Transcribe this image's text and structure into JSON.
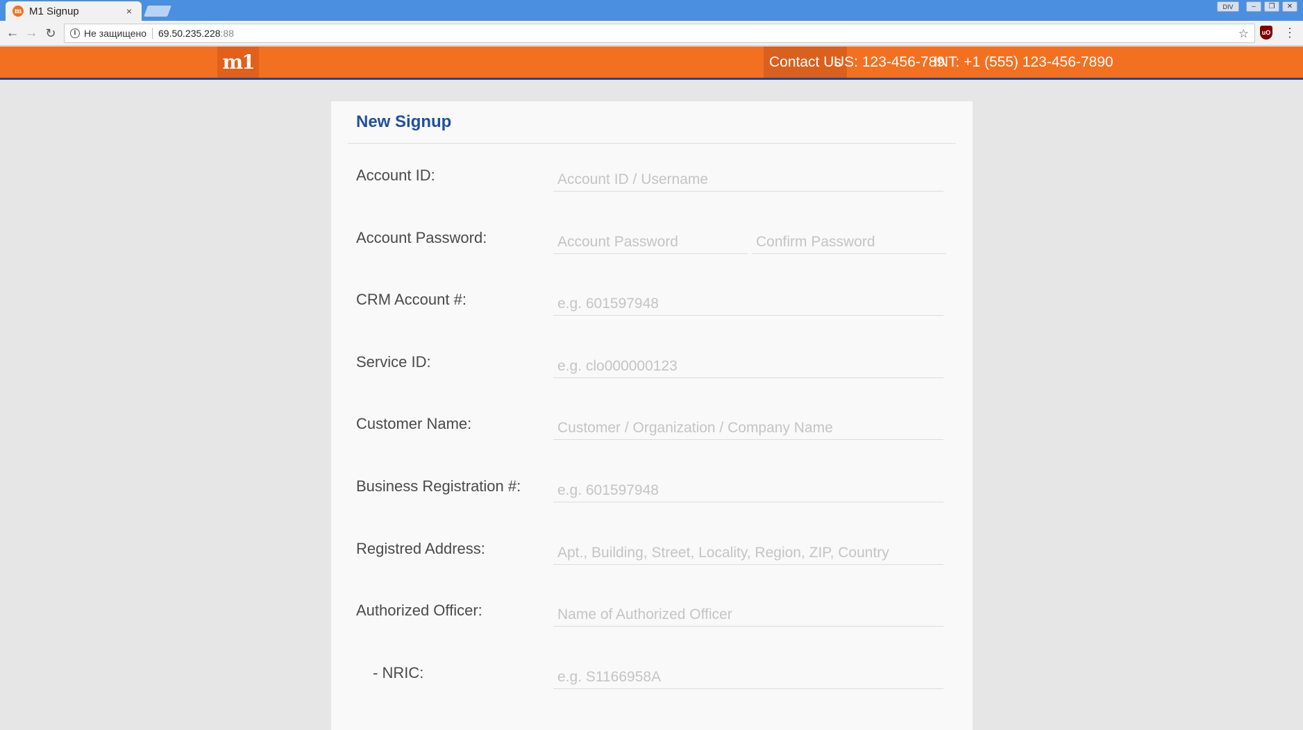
{
  "browser": {
    "tab_title": "M1 Signup",
    "tab_close": "×",
    "favicon_text": "m",
    "security_label": "Не защищено",
    "url_host": "69.50.235.228",
    "url_port": ":88",
    "div_label": "DIV"
  },
  "header": {
    "logo": "m1",
    "contact_label": "Contact Us",
    "phone_us": "US: 123-456-789",
    "phone_int": "INT: +1 (555) 123-456-7890",
    "colors": {
      "bar": "#f37021",
      "accent": "#1f4a8a"
    }
  },
  "form": {
    "title": "New Signup",
    "fields": [
      {
        "label": "Account ID:",
        "placeholder": "Account ID / Username"
      },
      {
        "label": "Account Password:",
        "placeholder": "Account Password",
        "placeholder2": "Confirm Password"
      },
      {
        "label": "CRM Account #:",
        "placeholder": "e.g. 601597948"
      },
      {
        "label": "Service ID:",
        "placeholder": "e.g. clo000000123"
      },
      {
        "label": "Customer Name:",
        "placeholder": "Customer / Organization / Company Name"
      },
      {
        "label": "Business Registration #:",
        "placeholder": "e.g. 601597948"
      },
      {
        "label": "Registred Address:",
        "placeholder": "Apt., Building, Street, Locality, Region, ZIP, Country"
      },
      {
        "label": "Authorized Officer:",
        "placeholder": "Name of Authorized Officer"
      },
      {
        "label": "- NRIC:",
        "placeholder": "e.g. S1166958A"
      }
    ]
  }
}
